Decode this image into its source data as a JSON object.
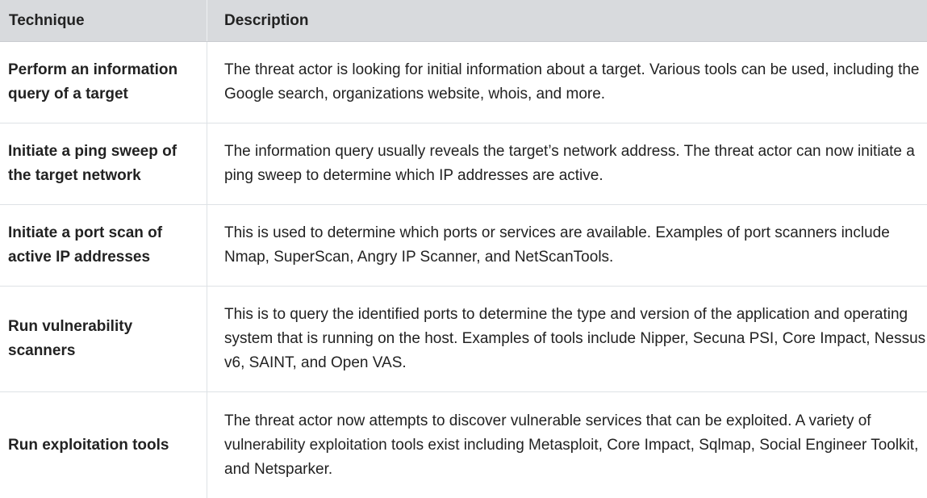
{
  "table": {
    "headers": {
      "technique": "Technique",
      "description": "Description"
    },
    "rows": [
      {
        "technique": "Perform an information query of a target",
        "description": "The threat actor is looking for initial information about a target. Various tools can be used, including the Google search, organizations website, whois, and more."
      },
      {
        "technique": "Initiate a ping sweep of the target network",
        "description": "The information query usually reveals the target’s network address. The threat actor can now initiate a ping sweep to determine which IP addresses are active."
      },
      {
        "technique": "Initiate a port scan of active IP addresses",
        "description": "This is used to determine which ports or services are available. Examples of port scanners include Nmap, SuperScan, Angry IP Scanner, and NetScanTools."
      },
      {
        "technique": "Run vulnerability scanners",
        "description": "This is to query the identified ports to determine the type and version of the application and operating system that is running on the host. Examples of tools include Nipper, Secuna PSI, Core Impact, Nessus v6, SAINT, and Open VAS."
      },
      {
        "technique": "Run exploitation tools",
        "description": "The threat actor now attempts to discover vulnerable services that can be exploited. A variety of vulnerability exploitation tools exist including Metasploit, Core Impact, Sqlmap, Social Engineer Toolkit, and Netsparker."
      }
    ]
  }
}
